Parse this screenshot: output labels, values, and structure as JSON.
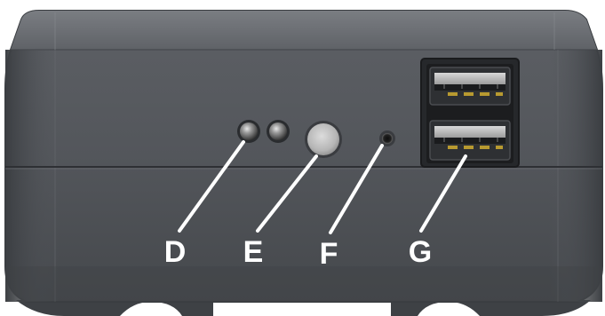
{
  "callouts": {
    "d": "D",
    "e": "E",
    "f": "F",
    "g": "G"
  },
  "colors": {
    "device_body": "#55585d",
    "device_top": "#6b6e73",
    "callout_line": "#ffffff",
    "callout_text": "#ffffff"
  }
}
